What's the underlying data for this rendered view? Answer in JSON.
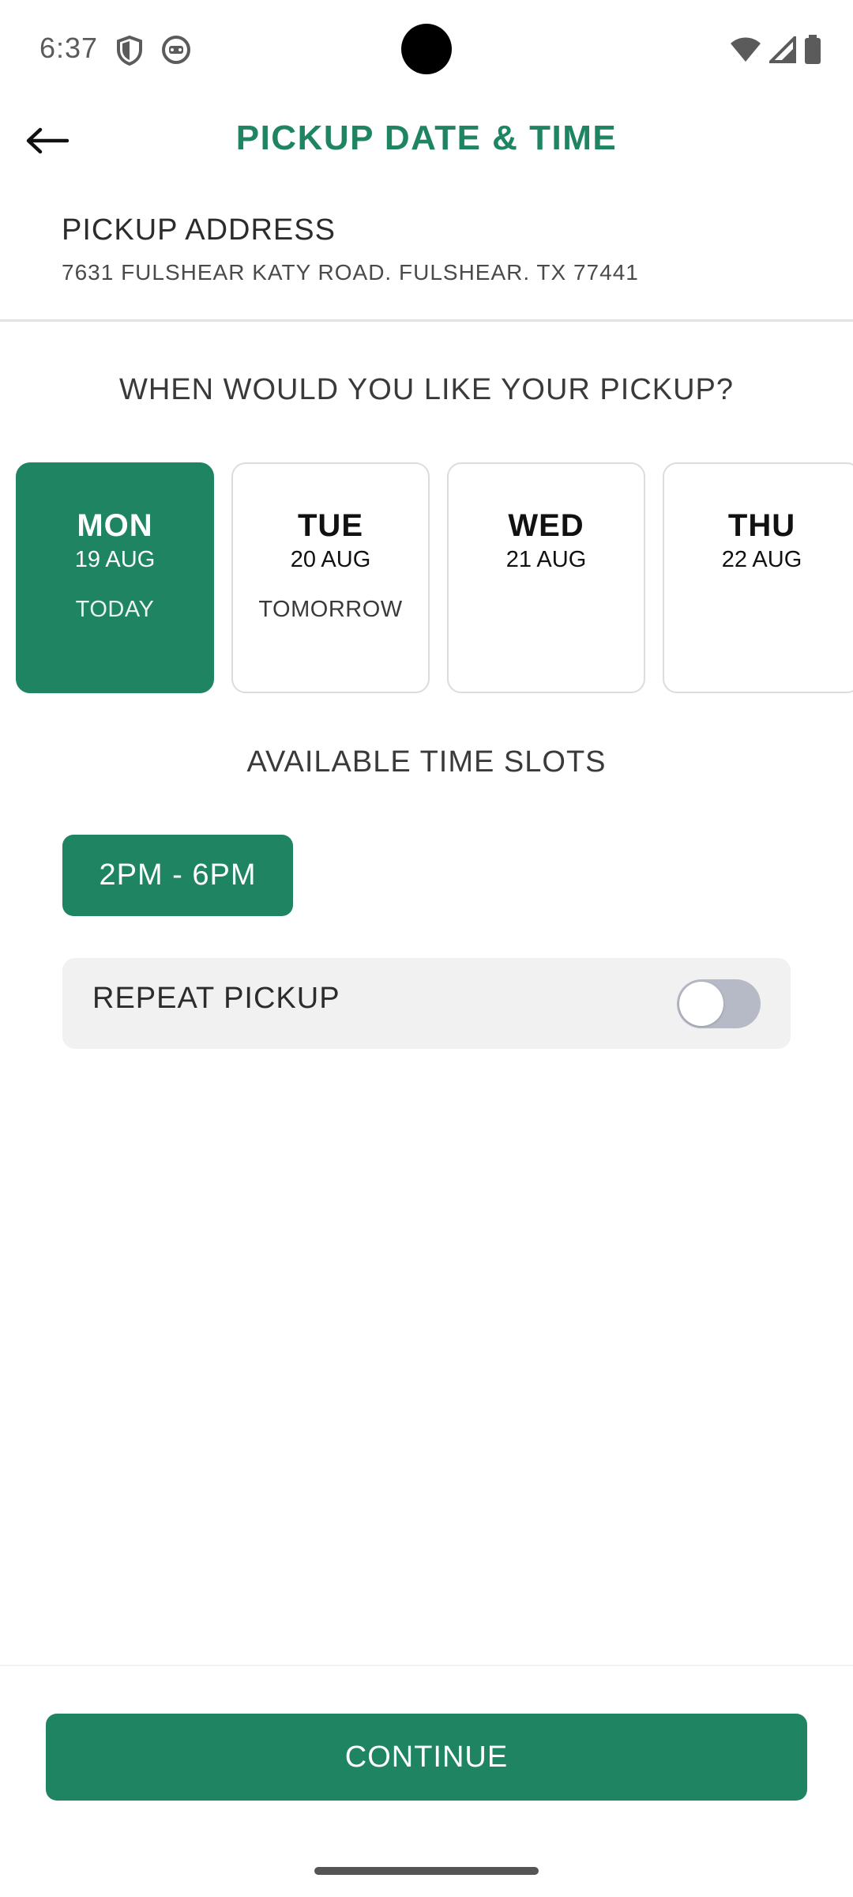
{
  "status_bar": {
    "time": "6:37",
    "left_icons": [
      "shield-icon",
      "app-notification-icon"
    ],
    "right_icons": [
      "wifi-icon",
      "signal-icon",
      "battery-icon"
    ]
  },
  "header": {
    "title": "PICKUP DATE & TIME",
    "back_icon": "arrow-left-icon"
  },
  "address": {
    "label": "PICKUP ADDRESS",
    "value": "7631 FULSHEAR KATY ROAD. FULSHEAR. TX 77441"
  },
  "question": "WHEN WOULD YOU LIKE YOUR PICKUP?",
  "dates": [
    {
      "day": "MON",
      "date": "19 AUG",
      "sub": "TODAY",
      "selected": true
    },
    {
      "day": "TUE",
      "date": "20 AUG",
      "sub": "TOMORROW",
      "selected": false
    },
    {
      "day": "WED",
      "date": "21 AUG",
      "sub": "",
      "selected": false
    },
    {
      "day": "THU",
      "date": "22 AUG",
      "sub": "",
      "selected": false
    }
  ],
  "time_slots": {
    "title": "AVAILABLE TIME SLOTS",
    "slots": [
      "2PM - 6PM"
    ]
  },
  "repeat_pickup": {
    "label": "REPEAT PICKUP",
    "enabled": false
  },
  "continue_label": "CONTINUE",
  "colors": {
    "brand_green": "#1f8462",
    "toggle_off": "#b5bac6"
  }
}
